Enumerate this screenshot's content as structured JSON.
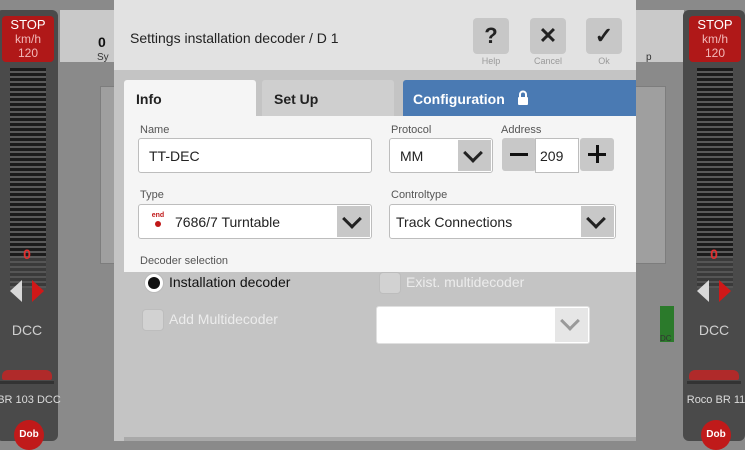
{
  "left_panel": {
    "stop": "STOP",
    "unit": "km/h",
    "speed": "120",
    "zero": "0",
    "protocol": "DCC",
    "loco_name": "BR 103 DCC",
    "fn_label": "Dob"
  },
  "right_panel": {
    "stop": "STOP",
    "unit": "km/h",
    "speed": "120",
    "zero": "0",
    "protocol": "DCC",
    "loco_name": "Roco BR 11",
    "fn_label": "Dob"
  },
  "background": {
    "left_count": "0",
    "left_sub": "Sy",
    "right_sub": "p",
    "dcc_label": "DC"
  },
  "dialog": {
    "title": "Settings installation decoder / D 1",
    "buttons": [
      {
        "glyph": "?",
        "label": "Help",
        "icon": "help-icon"
      },
      {
        "glyph": "✕",
        "label": "Cancel",
        "icon": "close-icon"
      },
      {
        "glyph": "✓",
        "label": "Ok",
        "icon": "check-icon"
      }
    ],
    "tabs": [
      {
        "label": "Info",
        "active": true
      },
      {
        "label": "Set Up",
        "active": false
      },
      {
        "label": "Configuration",
        "active": false,
        "icon": "lock-icon"
      }
    ],
    "form": {
      "name_label": "Name",
      "name_value": "TT-DEC",
      "protocol_label": "Protocol",
      "protocol_value": "MM",
      "address_label": "Address",
      "address_value": "209",
      "type_label": "Type",
      "type_value": "7686/7 Turntable",
      "type_icon_text": "end",
      "controltype_label": "Controltype",
      "controltype_value": "Track Connections",
      "decoder_selection_label": "Decoder selection",
      "options": {
        "installation": "Installation decoder",
        "exist_multi": "Exist. multidecoder",
        "add_multi": "Add Multidecoder"
      },
      "multidecoder_value": ""
    }
  },
  "colors": {
    "accent": "#4a7ab3",
    "stop_red": "#b01818"
  }
}
